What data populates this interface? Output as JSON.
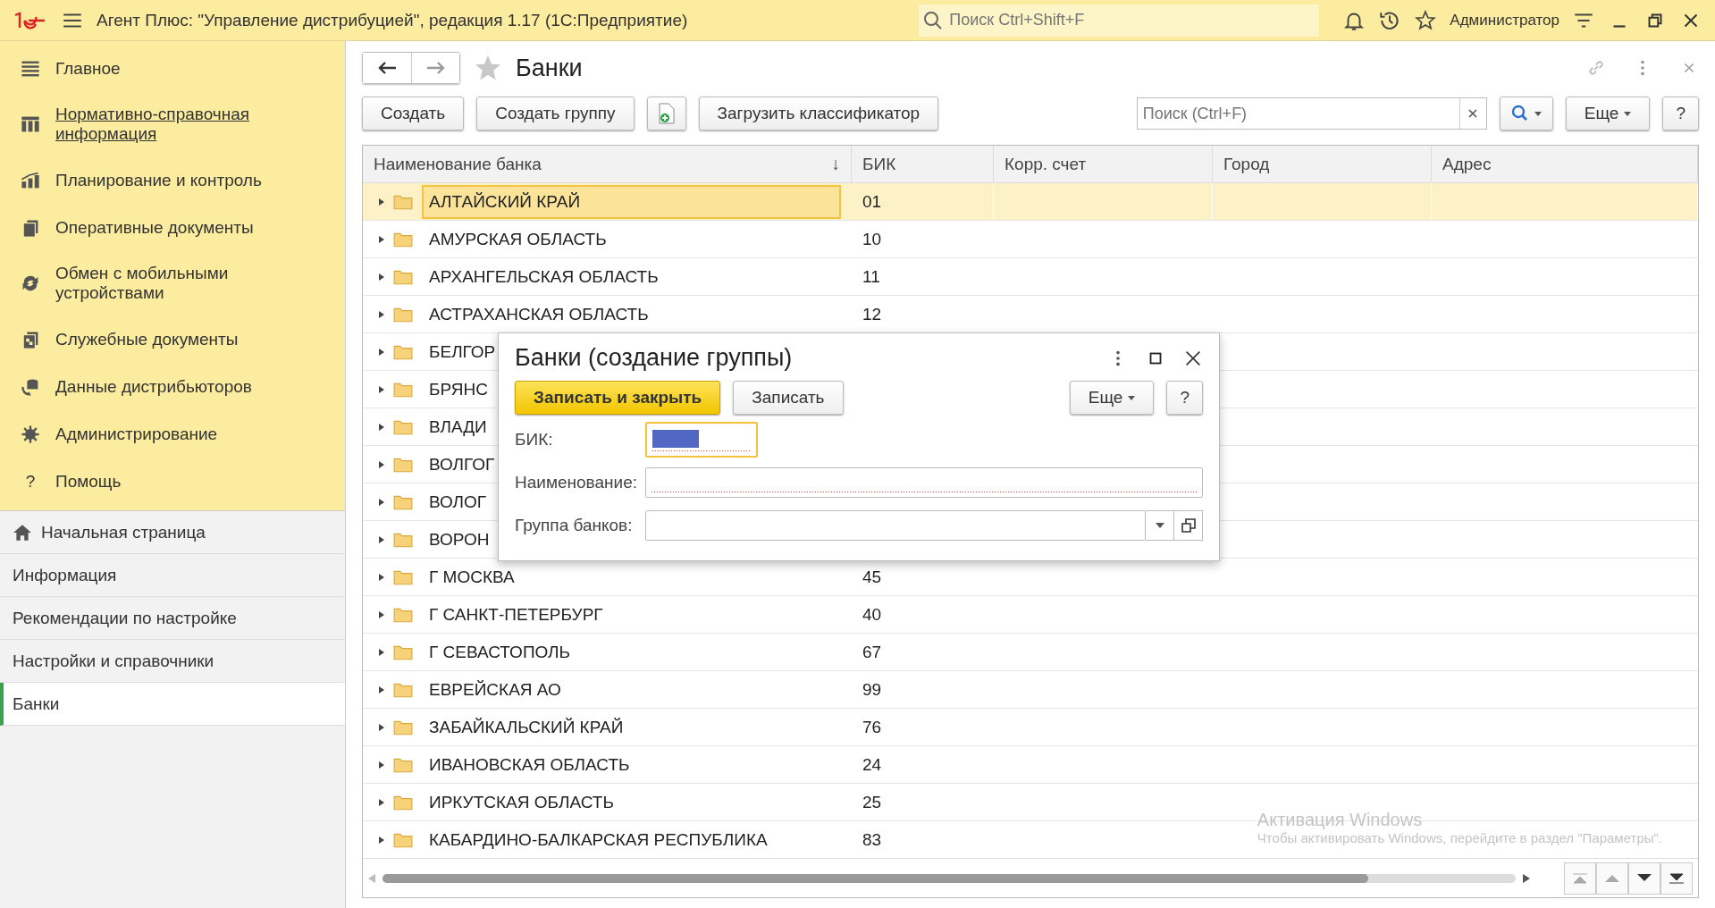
{
  "title_bar": {
    "title": "Агент Плюс: \"Управление дистрибуцией\", редакция 1.17  (1С:Предприятие)",
    "search": {
      "placeholder": "Поиск Ctrl+Shift+F"
    },
    "user": "Администратор"
  },
  "sidebar": {
    "sections": [
      {
        "label": "Главное",
        "selected": false
      },
      {
        "label": "Нормативно-справочная информация",
        "selected": true
      },
      {
        "label": "Планирование и контроль",
        "selected": false
      },
      {
        "label": "Оперативные документы",
        "selected": false
      },
      {
        "label": "Обмен с мобильными устройствами",
        "selected": false
      },
      {
        "label": "Служебные документы",
        "selected": false
      },
      {
        "label": "Данные дистрибьюторов",
        "selected": false
      },
      {
        "label": "Администрирование",
        "selected": false
      },
      {
        "label": "Помощь",
        "icon_char": "?",
        "selected": false
      }
    ],
    "open_pages": [
      {
        "label": "Начальная страница",
        "kind": "home",
        "selected": false
      },
      {
        "label": "Информация",
        "kind": "page",
        "selected": false
      },
      {
        "label": "Рекомендации по настройке",
        "kind": "page",
        "selected": false
      },
      {
        "label": "Настройки и справочники",
        "kind": "page",
        "selected": false
      },
      {
        "label": "Банки",
        "kind": "page",
        "selected": true
      }
    ]
  },
  "page": {
    "title": "Банки",
    "buttons": [
      "Создать",
      "Создать группу"
    ],
    "load_button": "Загрузить классификатор",
    "search": {
      "placeholder": "Поиск (Ctrl+F)"
    },
    "more": "Еще",
    "help": "?",
    "table": {
      "columns": [
        "Наименование банка",
        "БИК",
        "Корр. счет",
        "Город",
        "Адрес"
      ],
      "sort_mark": "↓",
      "rows": [
        {
          "name": "АЛТАЙСКИЙ КРАЙ",
          "bik": "01",
          "selected": true
        },
        {
          "name": "АМУРСКАЯ ОБЛАСТЬ",
          "bik": "10",
          "selected": false
        },
        {
          "name": "АРХАНГЕЛЬСКАЯ ОБЛАСТЬ",
          "bik": "11",
          "selected": false
        },
        {
          "name": "АСТРАХАНСКАЯ ОБЛАСТЬ",
          "bik": "12",
          "selected": false
        },
        {
          "name": "БЕЛГОР",
          "selected": false
        },
        {
          "name": "БРЯНС",
          "selected": false
        },
        {
          "name": "ВЛАДИ",
          "selected": false
        },
        {
          "name": "ВОЛГОГ",
          "selected": false
        },
        {
          "name": "ВОЛОГ",
          "selected": false
        },
        {
          "name": "ВОРОН",
          "selected": false
        },
        {
          "name": "Г МОСКВА",
          "bik": "45",
          "selected": false
        },
        {
          "name": "Г САНКТ-ПЕТЕРБУРГ",
          "bik": "40",
          "selected": false
        },
        {
          "name": "Г СЕВАСТОПОЛЬ",
          "bik": "67",
          "selected": false
        },
        {
          "name": "ЕВРЕЙСКАЯ АО",
          "bik": "99",
          "selected": false
        },
        {
          "name": "ЗАБАЙКАЛЬСКИЙ КРАЙ",
          "bik": "76",
          "selected": false
        },
        {
          "name": "ИВАНОВСКАЯ ОБЛАСТЬ",
          "bik": "24",
          "selected": false
        },
        {
          "name": "ИРКУТСКАЯ ОБЛАСТЬ",
          "bik": "25",
          "selected": false
        },
        {
          "name": "КАБАРДИНО-БАЛКАРСКАЯ РЕСПУБЛИКА",
          "bik": "83",
          "selected": false
        }
      ]
    }
  },
  "dialog": {
    "title": "Банки (создание группы)",
    "primary_button": "Записать и закрыть",
    "save_button": "Записать",
    "more": "Еще",
    "help": "?",
    "fields": [
      {
        "label": "БИК:",
        "kind": "short",
        "focused": true,
        "required": true
      },
      {
        "label": "Наименование:",
        "kind": "text",
        "focused": false,
        "required": true
      },
      {
        "label": "Группа банков:",
        "kind": "choice",
        "focused": false,
        "required": false
      }
    ]
  },
  "os_watermark": {
    "title": "Активация Windows",
    "text": "Чтобы активировать Windows, перейдите в раздел \"Параметры\"."
  }
}
